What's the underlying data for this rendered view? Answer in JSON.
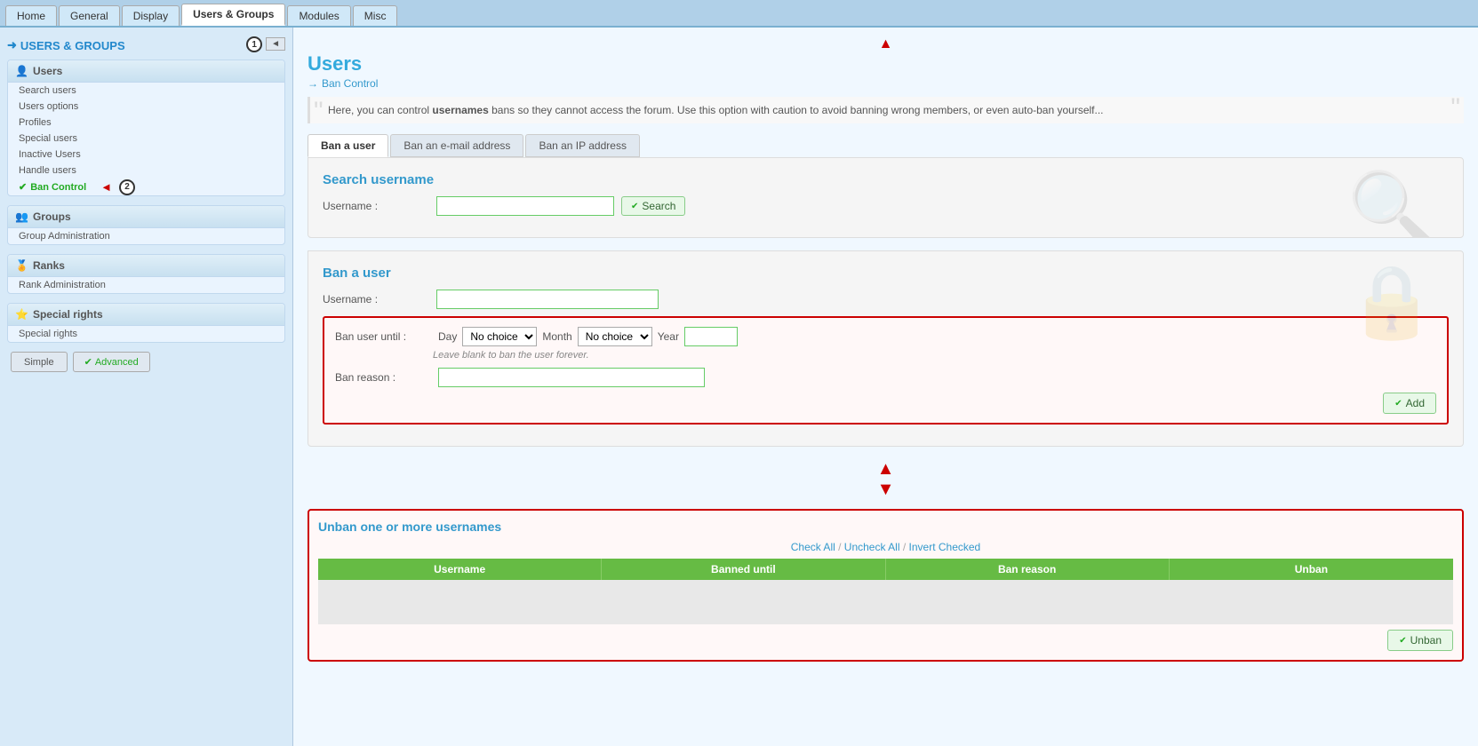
{
  "topnav": {
    "tabs": [
      {
        "label": "Home",
        "active": false
      },
      {
        "label": "General",
        "active": false
      },
      {
        "label": "Display",
        "active": false
      },
      {
        "label": "Users & Groups",
        "active": true
      },
      {
        "label": "Modules",
        "active": false
      },
      {
        "label": "Misc",
        "active": false
      }
    ]
  },
  "sidebar": {
    "header": "USERS & GROUPS",
    "collapse_btn": "◄",
    "users_section": {
      "title": "Users",
      "items": [
        {
          "label": "Search users",
          "active": false
        },
        {
          "label": "Users options",
          "active": false
        },
        {
          "label": "Profiles",
          "active": false
        },
        {
          "label": "Special users",
          "active": false
        },
        {
          "label": "Inactive Users",
          "active": false
        },
        {
          "label": "Handle users",
          "active": false
        },
        {
          "label": "Ban Control",
          "active": true
        }
      ]
    },
    "groups_section": {
      "title": "Groups",
      "items": [
        {
          "label": "Group Administration",
          "active": false
        }
      ]
    },
    "ranks_section": {
      "title": "Ranks",
      "items": [
        {
          "label": "Rank Administration",
          "active": false
        }
      ]
    },
    "special_rights_section": {
      "title": "Special rights",
      "items": [
        {
          "label": "Special rights",
          "active": false
        }
      ]
    },
    "buttons": {
      "simple": "Simple",
      "advanced": "Advanced"
    }
  },
  "main": {
    "page_title": "Users",
    "page_subtitle": "Ban Control",
    "quote_text": "Here, you can control usernames bans so they cannot access the forum. Use this option with caution to avoid banning wrong members, or even auto-ban yourself...",
    "tabs": [
      {
        "label": "Ban a user",
        "active": true
      },
      {
        "label": "Ban an e-mail address",
        "active": false
      },
      {
        "label": "Ban an IP address",
        "active": false
      }
    ],
    "search_panel": {
      "title": "Search username",
      "username_label": "Username :",
      "search_btn": "Search"
    },
    "ban_panel": {
      "title": "Ban a user",
      "username_label": "Username :",
      "ban_until_label": "Ban user until :",
      "day_label": "Day",
      "month_label": "Month",
      "year_label": "Year",
      "day_options": [
        "No choice"
      ],
      "month_options": [
        "No choice"
      ],
      "hint": "Leave blank to ban the user forever.",
      "ban_reason_label": "Ban reason :",
      "add_btn": "Add"
    },
    "unban_panel": {
      "title": "Unban one or more usernames",
      "check_all": "Check All",
      "uncheck_all": "Uncheck All",
      "invert_checked": "Invert Checked",
      "separator1": "/",
      "separator2": "/",
      "columns": [
        "Username",
        "Banned until",
        "Ban reason",
        "Unban"
      ],
      "unban_btn": "Unban"
    }
  },
  "annotations": {
    "num1": "1",
    "num2": "2"
  }
}
